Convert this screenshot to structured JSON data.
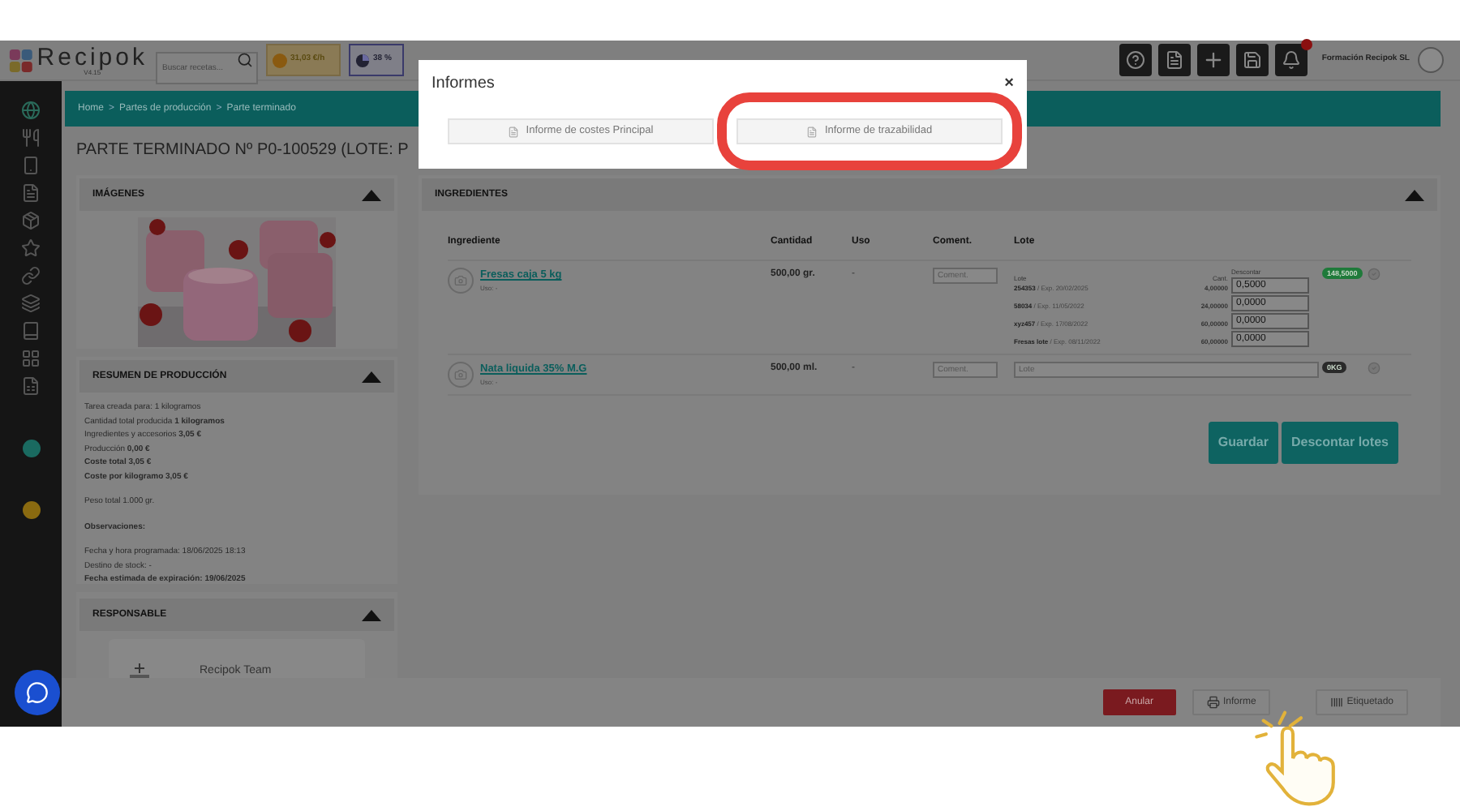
{
  "topbar": {
    "logo": "Recipok",
    "version": "V4.15",
    "search": {
      "placeholder": "Buscar recetas..."
    },
    "cost_badge": "31,03 €/h",
    "percent_badge": "38 %",
    "notifications": {
      "unread": true
    },
    "company": "Formación Recipok SL"
  },
  "breadcrumb": {
    "separator": ">",
    "items": [
      "Home",
      "Partes de producción",
      "Parte terminado"
    ]
  },
  "title": "PARTE TERMINADO Nº P0-100529 (LOTE: P",
  "images_panel": {
    "title": "IMÁGENES",
    "expanded": true
  },
  "summary_panel": {
    "title": "RESUMEN DE PRODUCCIÓN",
    "expanded": true,
    "groups": [
      [
        {
          "text": "Tarea creada para: 1 kilogramos",
          "bold": false
        },
        {
          "text": "Cantidad total producida **1 kilogramos**",
          "bold": false
        },
        {
          "text": "Ingredientes y accesorios **3,05 €**",
          "bold": false
        },
        {
          "text": "Producción **0,00 €**",
          "bold": false
        },
        {
          "text": "Coste total 3,05 €",
          "bold": true
        },
        {
          "text": "Coste por kilogramo 3,05 €",
          "bold": true
        }
      ],
      [
        {
          "text": "Peso total 1.000 gr.",
          "bold": false
        }
      ],
      [
        {
          "text": "Observaciones:",
          "bold": true
        }
      ],
      [
        {
          "text": "Fecha y hora programada: 18/06/2025 18:13",
          "bold": false
        },
        {
          "text": "Destino de stock: -",
          "bold": false
        },
        {
          "text": "Fecha estimada de expiración: 19/06/2025",
          "bold": true
        }
      ]
    ]
  },
  "responsible_panel": {
    "title": "RESPONSABLE",
    "expanded": true,
    "name": "Recipok Team"
  },
  "ingredients_panel": {
    "title": "INGREDIENTES",
    "expanded": true,
    "columns": [
      "Ingrediente",
      "Cantidad",
      "Uso",
      "Coment.",
      "Lote"
    ],
    "rows": [
      {
        "name": "Fresas caja 5 kg",
        "usage_note": "Uso: -",
        "quantity": "500,00 gr.",
        "usage": "-",
        "comment_placeholder": "Coment.",
        "badge": "148,5000",
        "color": "#1f7a3a",
        "lots": {
          "kind": "table",
          "headers": [
            "Lote",
            "Cant.",
            "Descontar"
          ],
          "rows": [
            {
              "lot": "254353",
              "expiry": "/ Exp. 20/02/2025",
              "amount": "4,00000",
              "discount": "0,5000"
            },
            {
              "lot": "58034",
              "expiry": "/ Exp. 11/05/2022",
              "amount": "24,00000",
              "discount": "0,0000"
            },
            {
              "lot": "xyz457",
              "expiry": "/ Exp. 17/08/2022",
              "amount": "60,00000",
              "discount": "0,0000"
            },
            {
              "lot": "Fresas lote",
              "expiry": "/ Exp. 08/11/2022",
              "amount": "60,00000",
              "discount": "0,0000"
            }
          ]
        }
      },
      {
        "name": "Nata liquida 35% M.G",
        "usage_note": "Uso: -",
        "quantity": "500,00 ml.",
        "usage": "-",
        "comment_placeholder": "Coment.",
        "badge": "0KG",
        "color": "#2a2a2a",
        "lots": {
          "kind": "field",
          "placeholder": "Lote"
        }
      }
    ],
    "buttons": [
      "Guardar",
      "Descontar lotes"
    ]
  },
  "footer_buttons": [
    {
      "label": "Anular",
      "kind": "danger"
    },
    {
      "label": "Informe",
      "kind": "print"
    },
    {
      "label": "Etiquetado",
      "kind": "label"
    }
  ],
  "modal": {
    "title": "Informes",
    "close": "×",
    "buttons": [
      {
        "label": "Informe de costes Principal",
        "highlighted": false
      },
      {
        "label": "Informe de trazabilidad",
        "highlighted": true
      }
    ]
  }
}
